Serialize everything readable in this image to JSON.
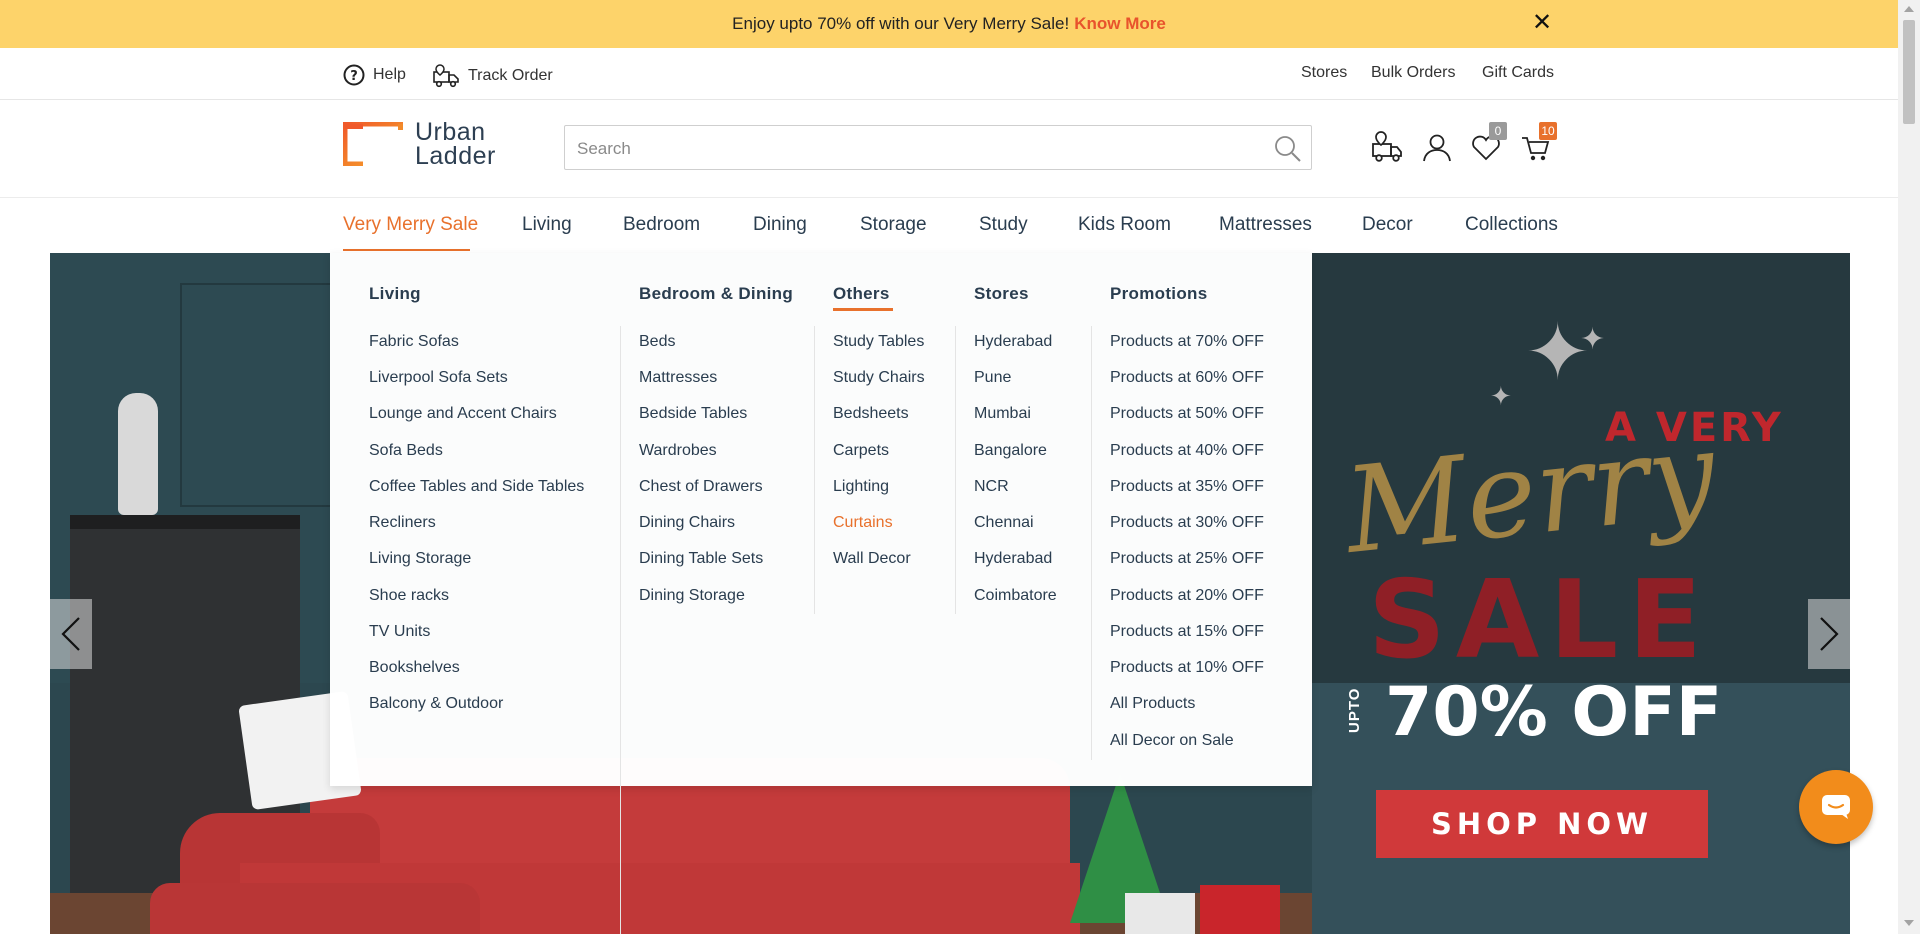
{
  "promo_bar": {
    "text": "Enjoy upto 70% off with our Very Merry Sale!",
    "link": "Know More",
    "close_glyph": "✕"
  },
  "utility": {
    "help": "Help",
    "track_order": "Track Order",
    "stores": "Stores",
    "bulk_orders": "Bulk Orders",
    "gift_cards": "Gift Cards"
  },
  "header": {
    "logo_line1": "Urban",
    "logo_line2": "Ladder",
    "search_placeholder": "Search",
    "wishlist_count": "0",
    "cart_count": "10",
    "icons": [
      "track-order-icon",
      "user-icon",
      "heart-icon",
      "cart-icon",
      "search-icon"
    ]
  },
  "nav": {
    "items": [
      "Very Merry Sale",
      "Living",
      "Bedroom",
      "Dining",
      "Storage",
      "Study",
      "Kids Room",
      "Mattresses",
      "Decor",
      "Collections"
    ],
    "active": "Very Merry Sale"
  },
  "mega_menu": {
    "columns": [
      {
        "heading": "Living",
        "items": [
          "Fabric Sofas",
          "Liverpool Sofa Sets",
          "Lounge and Accent Chairs",
          "Sofa Beds",
          "Coffee Tables and Side Tables",
          "Recliners",
          "Living Storage",
          "Shoe racks",
          "TV Units",
          "Bookshelves",
          "Balcony & Outdoor"
        ]
      },
      {
        "heading": "Bedroom & Dining",
        "items": [
          "Beds",
          "Mattresses",
          "Bedside Tables",
          "Wardrobes",
          "Chest of Drawers",
          "Dining Chairs",
          "Dining Table Sets",
          "Dining Storage"
        ]
      },
      {
        "heading": "Others",
        "items": [
          "Study Tables",
          "Study Chairs",
          "Bedsheets",
          "Carpets",
          "Lighting",
          "Curtains",
          "Wall Decor"
        ]
      },
      {
        "heading": "Stores",
        "items": [
          "Hyderabad",
          "Pune",
          "Mumbai",
          "Bangalore",
          "NCR",
          "Chennai",
          "Hyderabad",
          "Coimbatore"
        ]
      },
      {
        "heading": "Promotions",
        "items": [
          "Products at 70% OFF",
          "Products at 60% OFF",
          "Products at 50% OFF",
          "Products at 40% OFF",
          "Products at 35% OFF",
          "Products at 30% OFF",
          "Products at 25% OFF",
          "Products at 20% OFF",
          "Products at 15% OFF",
          "Products at 10% OFF",
          "All Products",
          "All Decor on Sale"
        ]
      }
    ],
    "highlighted_item": "Curtains"
  },
  "hero": {
    "line1": "A VERY",
    "line2": "Merry",
    "line3": "SALE",
    "upto": "UPTO",
    "discount": "70% OFF",
    "cta": "SHOP NOW"
  },
  "colors": {
    "promo_bg": "#fdd36a",
    "accent": "#e8712c",
    "text": "#2a3d4f",
    "cta": "#d0393a",
    "chat": "#f28c1b"
  }
}
